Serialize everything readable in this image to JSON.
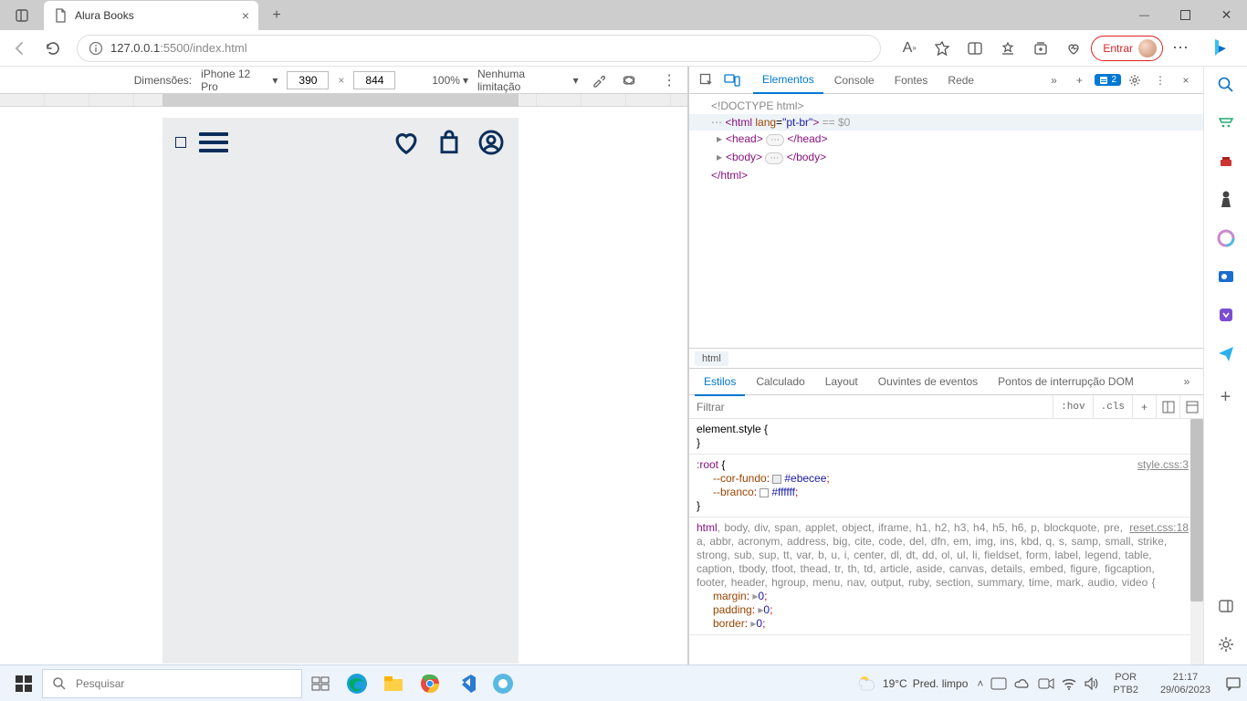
{
  "titlebar": {
    "tab_title": "Alura Books",
    "win_min": "—",
    "win_max": "▢",
    "win_close": "✕"
  },
  "addrbar": {
    "host": "127.0.0.1",
    "port_path": ":5500/index.html",
    "signin": "Entrar"
  },
  "device_bar": {
    "label": "Dimensões:",
    "device": "iPhone 12 Pro",
    "width": "390",
    "sep": "×",
    "height": "844",
    "zoom": "100%",
    "throttle": "Nenhuma limitação"
  },
  "devtools": {
    "tabs": {
      "elements": "Elementos",
      "console": "Console",
      "sources": "Fontes",
      "network": "Rede"
    },
    "badge_count": "2",
    "dom": {
      "doctype": "<!DOCTYPE html>",
      "html_open": "<html ",
      "lang_attr": "lang",
      "lang_val": "\"pt-br\"",
      "html_open_end": ">",
      "eq0": " == $0",
      "head_open": "<head>",
      "head_close": "</head>",
      "body_open": "<body>",
      "body_close": "</body>",
      "html_close": "</html>",
      "dots": "⋯"
    },
    "crumb": "html",
    "styles_tabs": {
      "styles": "Estilos",
      "computed": "Calculado",
      "layout": "Layout",
      "listeners": "Ouvintes de eventos",
      "breakpoints": "Pontos de interrupção DOM"
    },
    "filter_placeholder": "Filtrar",
    "hov": ":hov",
    "cls": ".cls",
    "rule1": {
      "sel": "element.style {",
      "close": "}"
    },
    "rule2": {
      "sel": ":root",
      "src": "style.css:3",
      "p1_name": "--cor-fundo",
      "p1_val": "#ebecee",
      "p2_name": "--branco",
      "p2_val": "#ffffff"
    },
    "rule3": {
      "src": "reset.css:18",
      "selectors": "html, body, div, span, applet, object, iframe, h1, h2, h3, h4, h5, h6, p, blockquote, pre, a, abbr, acronym, address, big, cite, code, del, dfn, em, img, ins, kbd, q, s, samp, small, strike, strong, sub, sup, tt, var, b, u, i, center, dl, dt, dd, ol, ul, li, fieldset, form, label, legend, table, caption, tbody, tfoot, thead, tr, th, td, article, aside, canvas, details, embed, figure, figcaption, footer, header, hgroup, menu, nav, output, ruby, section, summary, time, mark, audio, video {",
      "m": "margin",
      "p": "padding",
      "b": "border",
      "zero": "0"
    }
  },
  "taskbar": {
    "search_placeholder": "Pesquisar",
    "temp": "19°C",
    "cond": "Pred. limpo",
    "lang1": "POR",
    "lang2": "PTB2",
    "time": "21:17",
    "date": "29/06/2023"
  }
}
